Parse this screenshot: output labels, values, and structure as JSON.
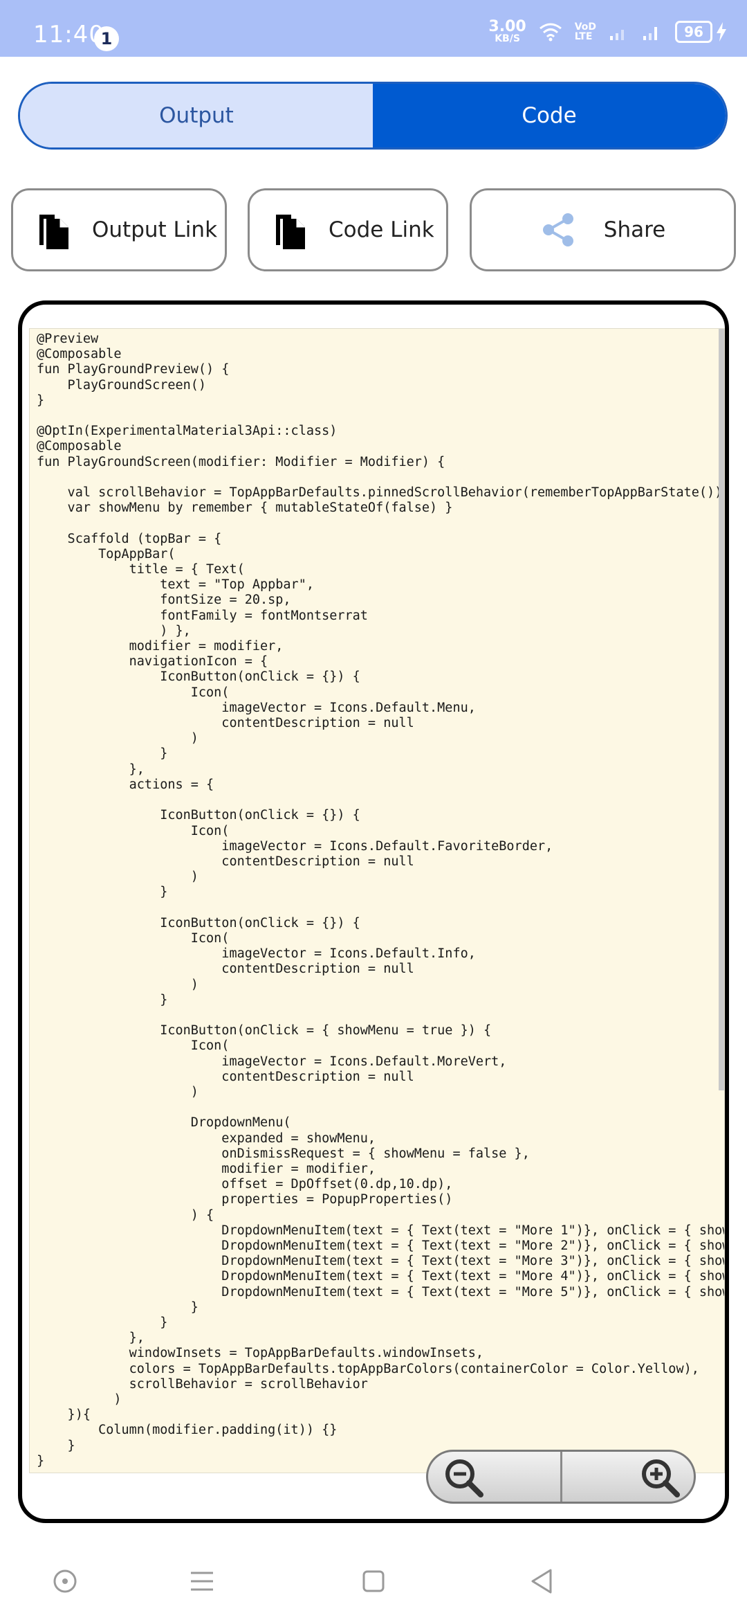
{
  "status_bar": {
    "time": "11:40",
    "notification_count": "1",
    "net_speed_value": "3.00",
    "net_speed_unit": "KB/S",
    "network_top": "VoD",
    "network_bottom": "LTE",
    "battery": "96"
  },
  "toggle": {
    "output_label": "Output",
    "code_label": "Code",
    "active": "Code"
  },
  "actions": {
    "output_link_label": "Output Link",
    "code_link_label": "Code Link",
    "share_label": "Share"
  },
  "code": "@Preview\n@Composable\nfun PlayGroundPreview() {\n    PlayGroundScreen()\n}\n\n@OptIn(ExperimentalMaterial3Api::class)\n@Composable\nfun PlayGroundScreen(modifier: Modifier = Modifier) {\n\n    val scrollBehavior = TopAppBarDefaults.pinnedScrollBehavior(rememberTopAppBarState())\n    var showMenu by remember { mutableStateOf(false) }\n\n    Scaffold (topBar = {\n        TopAppBar(\n            title = { Text(\n                text = \"Top Appbar\",\n                fontSize = 20.sp,\n                fontFamily = fontMontserrat\n                ) },\n            modifier = modifier,\n            navigationIcon = {\n                IconButton(onClick = {}) {\n                    Icon(\n                        imageVector = Icons.Default.Menu,\n                        contentDescription = null\n                    )\n                }\n            },\n            actions = {\n\n                IconButton(onClick = {}) {\n                    Icon(\n                        imageVector = Icons.Default.FavoriteBorder,\n                        contentDescription = null\n                    )\n                }\n\n                IconButton(onClick = {}) {\n                    Icon(\n                        imageVector = Icons.Default.Info,\n                        contentDescription = null\n                    )\n                }\n\n                IconButton(onClick = { showMenu = true }) {\n                    Icon(\n                        imageVector = Icons.Default.MoreVert,\n                        contentDescription = null\n                    )\n\n                    DropdownMenu(\n                        expanded = showMenu,\n                        onDismissRequest = { showMenu = false },\n                        modifier = modifier,\n                        offset = DpOffset(0.dp,10.dp),\n                        properties = PopupProperties()\n                    ) {\n                        DropdownMenuItem(text = { Text(text = \"More 1\")}, onClick = { showMenu = false })\n                        DropdownMenuItem(text = { Text(text = \"More 2\")}, onClick = { showMenu = false })\n                        DropdownMenuItem(text = { Text(text = \"More 3\")}, onClick = { showMenu = false })\n                        DropdownMenuItem(text = { Text(text = \"More 4\")}, onClick = { showMenu = false })\n                        DropdownMenuItem(text = { Text(text = \"More 5\")}, onClick = { showMenu = false })\n                    }\n                }\n            },\n            windowInsets = TopAppBarDefaults.windowInsets,\n            colors = TopAppBarDefaults.topAppBarColors(containerColor = Color.Yellow),\n            scrollBehavior = scrollBehavior\n          )\n    }){\n        Column(modifier.padding(it)) {}\n    }\n}",
  "colors": {
    "status_bar": "#aabff7",
    "toggle_active": "#005ad0",
    "toggle_inactive": "#d7e2fb",
    "code_background": "#fdf8e4"
  },
  "icons": {
    "output_link": "copy-file-icon",
    "code_link": "copy-file-icon",
    "share": "share-icon",
    "zoom_out": "zoom-out-icon",
    "zoom_in": "zoom-in-icon"
  }
}
